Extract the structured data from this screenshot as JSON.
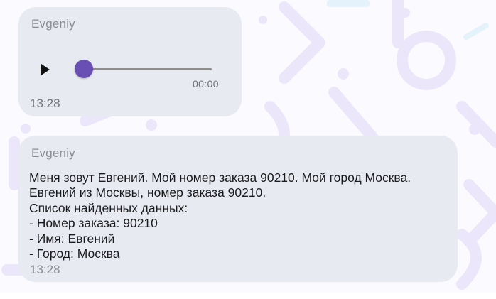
{
  "messages": [
    {
      "type": "audio",
      "sender": "Evgeniy",
      "player": {
        "play_icon": "play-icon",
        "progress": 0,
        "duration": "00:00"
      },
      "time": "13:28"
    },
    {
      "type": "text",
      "sender": "Evgeniy",
      "lines": [
        "Меня зовут Евгений. Мой номер заказа 90210. Мой город Москва.",
        "Евгений из Москвы, номер заказа 90210.",
        "Список найденных данных:",
        "- Номер заказа: 90210",
        "- Имя: Евгений",
        "- Город: Москва"
      ],
      "time": "13:28"
    }
  ],
  "colors": {
    "bubble": "#e7eaf0",
    "accent": "#6a4fb3",
    "background_pattern": "#ece6fa"
  }
}
